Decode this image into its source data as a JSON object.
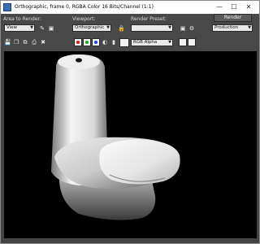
{
  "window": {
    "title": "Orthographic, frame 0, RGBA Color 16 Bits/Channel (1:1)"
  },
  "controls": {
    "area_to_render_label": "Area to Render:",
    "area_to_render_value": "View",
    "viewport_label": "Viewport:",
    "viewport_value": "Orthographic",
    "render_presets_label": "Render Preset:",
    "render_presets_value": "",
    "render_button": "Render",
    "production_value": "Production",
    "channel_value": "RGB Alpha"
  },
  "icons": {
    "minimize": "minimize-icon",
    "maximize": "maximize-icon",
    "close": "close-icon",
    "red_channel": "#d8171b",
    "green_channel": "#1ea81e",
    "blue_channel": "#1b3fd8"
  }
}
